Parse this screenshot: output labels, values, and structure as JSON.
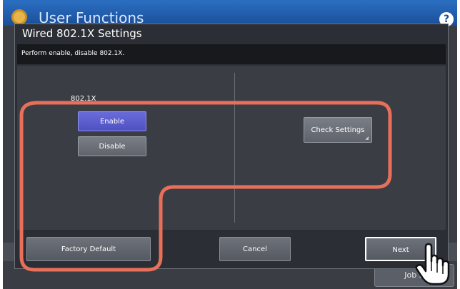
{
  "app": {
    "title": "User Functions",
    "help_icon": "help-icon",
    "job_status_label": "Job S"
  },
  "dialog": {
    "title": "Wired 802.1X Settings",
    "description": "Perform enable, disable 802.1X.",
    "section_label": "802.1X",
    "enable_label": "Enable",
    "disable_label": "Disable",
    "check_settings_label": "Check Settings",
    "factory_default_label": "Factory Default",
    "cancel_label": "Cancel",
    "next_label": "Next",
    "selected_option": "Enable"
  },
  "colors": {
    "header_blue": "#1a4f99",
    "enable_selected": "#5a5cd0",
    "highlight_outline": "#e8705a"
  }
}
